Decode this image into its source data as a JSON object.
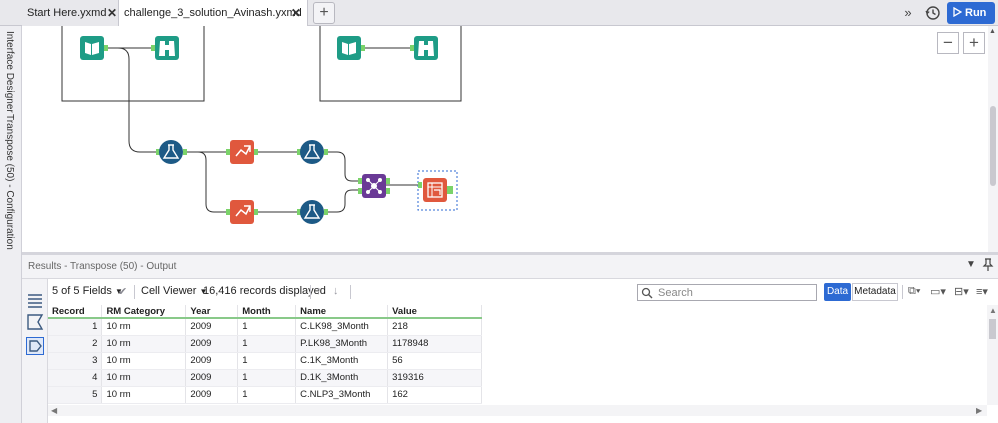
{
  "tabs": [
    {
      "label": "Start Here.yxmd",
      "close": "✕"
    },
    {
      "label": "challenge_3_solution_Avinash.yxmd",
      "close": "✕"
    }
  ],
  "tab_add": "+",
  "expand_glyph": "»",
  "run_label": "Run",
  "sidebar": {
    "interface_designer": "Interface Designer",
    "configuration": "Transpose (50) - Configuration"
  },
  "canvas": {
    "zoom_out": "−",
    "zoom_in": "+",
    "tools": [
      "input-data",
      "browse",
      "input-data",
      "browse",
      "formula",
      "select-records",
      "formula",
      "select-records",
      "formula",
      "join-multiple",
      "transpose"
    ]
  },
  "results": {
    "title": "Results - Transpose (50) - Output",
    "fields_label": "5 of 5 Fields",
    "viewer_label": "Cell Viewer",
    "records_label": "16,416 records displayed",
    "search_placeholder": "Search",
    "data_tab": "Data",
    "metadata_tab": "Metadata",
    "columns": [
      "Record",
      "RM Category",
      "Year",
      "Month",
      "Name",
      "Value"
    ],
    "rows": [
      [
        "1",
        "10 rm",
        "2009",
        "1",
        "C.LK98_3Month",
        "218"
      ],
      [
        "2",
        "10 rm",
        "2009",
        "1",
        "P.LK98_3Month",
        "1178948"
      ],
      [
        "3",
        "10 rm",
        "2009",
        "1",
        "C.1K_3Month",
        "56"
      ],
      [
        "4",
        "10 rm",
        "2009",
        "1",
        "D.1K_3Month",
        "319316"
      ],
      [
        "5",
        "10 rm",
        "2009",
        "1",
        "C.NLP3_3Month",
        "162"
      ]
    ]
  },
  "colors": {
    "accent": "#2d6ad3",
    "input_tool": "#1e9c86",
    "formula_tool": "#1d5a86",
    "select_tool": "#e0583d",
    "join_tool": "#6a3a96",
    "transpose_tool": "#e0583d"
  }
}
